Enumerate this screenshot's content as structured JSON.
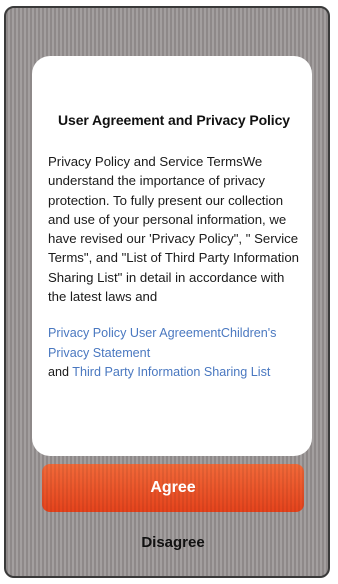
{
  "dialog": {
    "title": "User Agreement and Privacy Policy",
    "body": "Privacy Policy and Service TermsWe understand the importance of privacy protection. To fully present our collection and use of your personal information, we have revised our 'Privacy Policy\", \" Service Terms\", and \"List of Third Party Information Sharing List\" in detail in accordance with the latest laws and",
    "links": {
      "privacy_user_agreement": "Privacy Policy User AgreementChildren's Privacy Statement",
      "conjunction": "and ",
      "third_party_list": "Third Party Information Sharing List"
    }
  },
  "actions": {
    "agree_label": "Agree",
    "disagree_label": "Disagree"
  },
  "colors": {
    "accent": "#e8502a",
    "link": "#4a78c0"
  }
}
